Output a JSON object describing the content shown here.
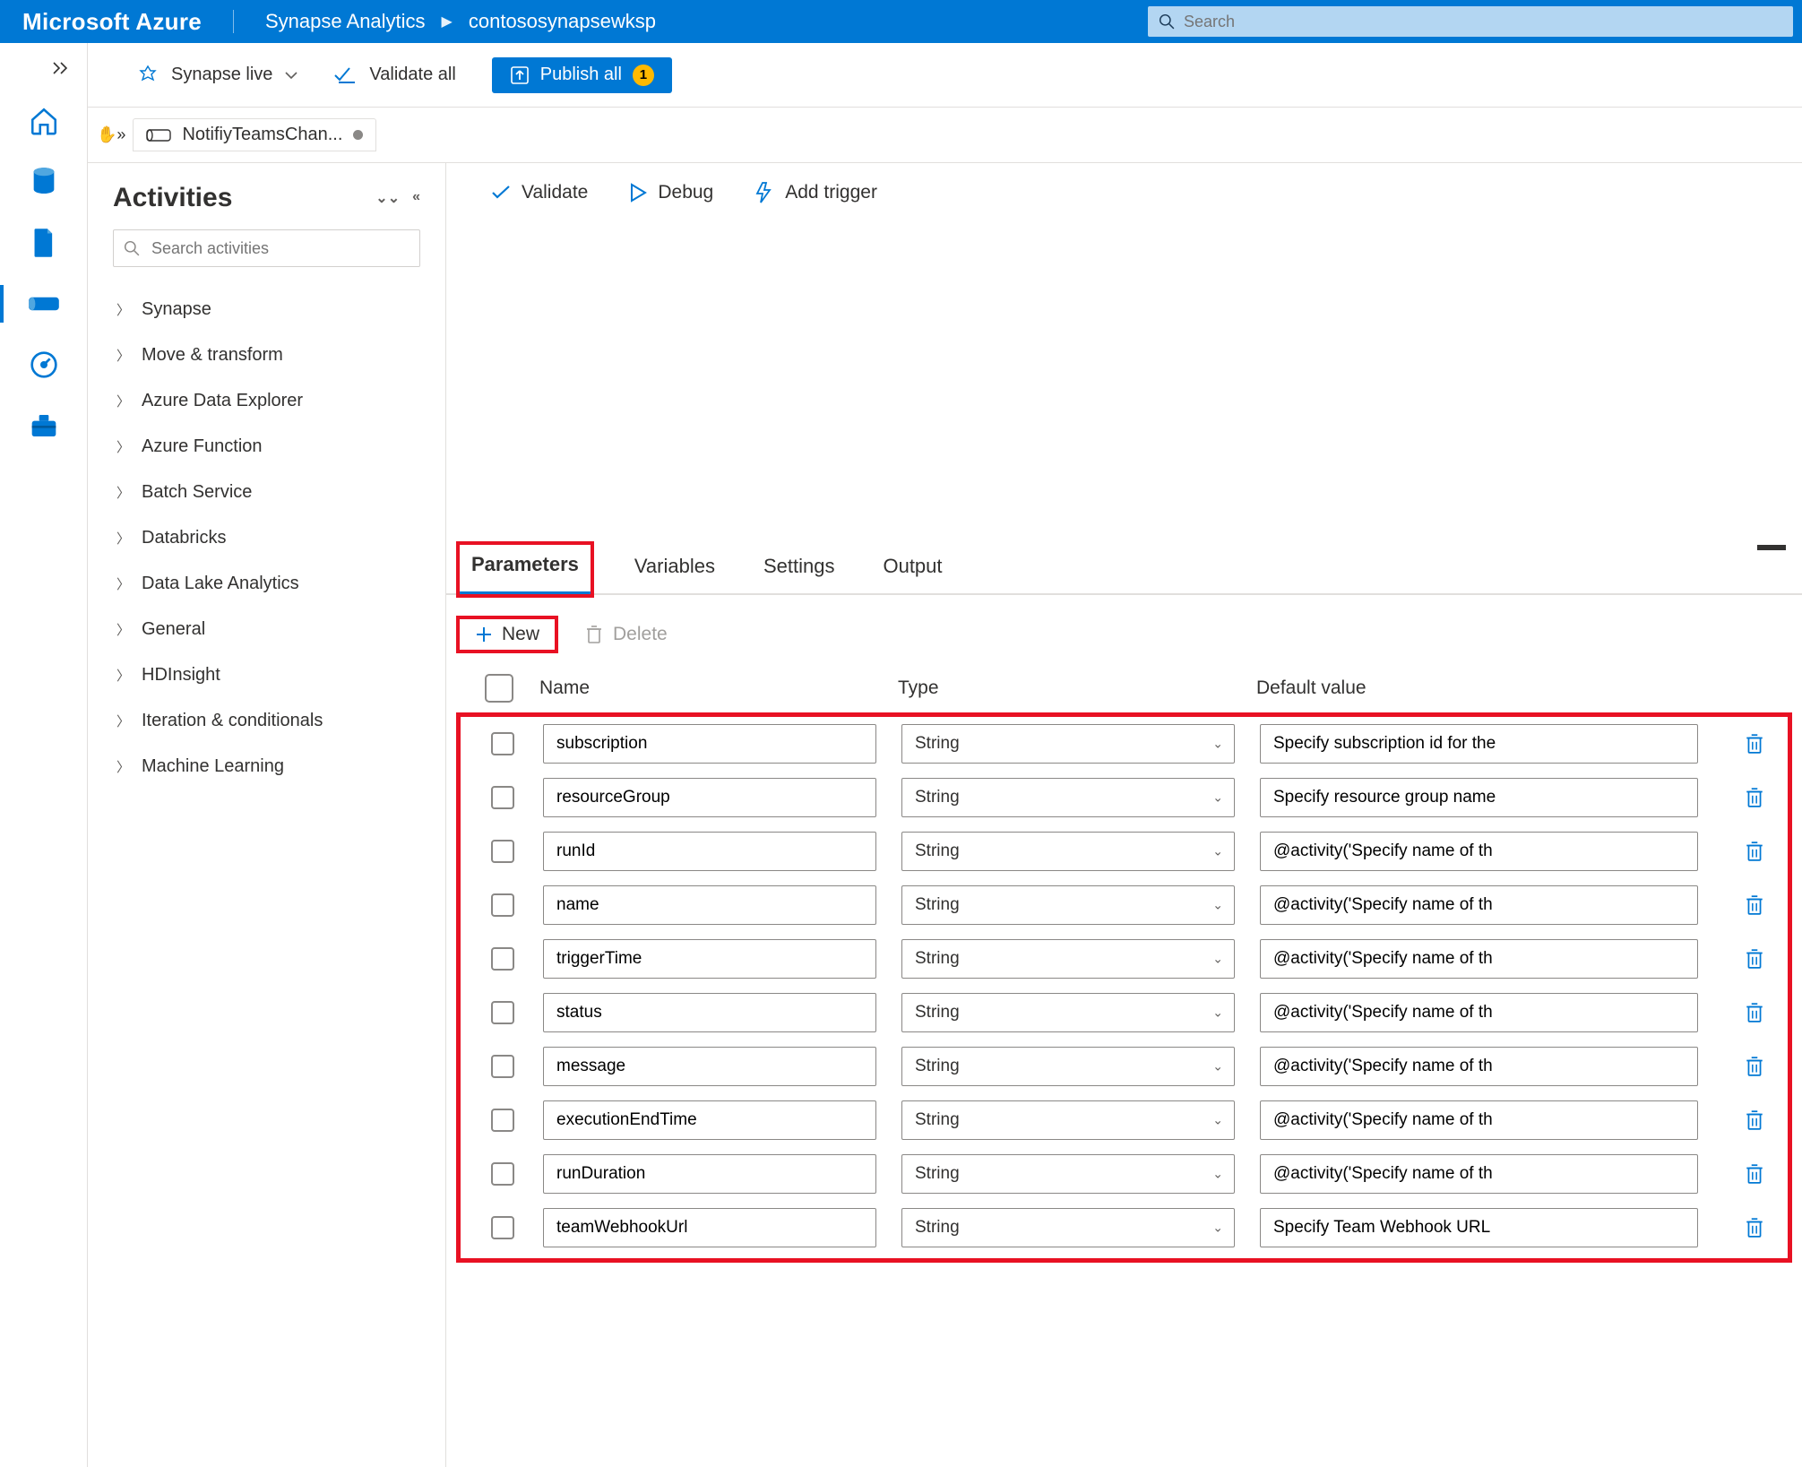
{
  "header": {
    "brand": "Microsoft Azure",
    "breadcrumb_service": "Synapse Analytics",
    "breadcrumb_workspace": "contososynapsewksp",
    "search_placeholder": "Search"
  },
  "actionbar": {
    "live_label": "Synapse live",
    "validate_all": "Validate all",
    "publish_all": "Publish all",
    "publish_badge": "1"
  },
  "pipeline_tab": {
    "name": "NotifiyTeamsChan..."
  },
  "activities_panel": {
    "title": "Activities",
    "search_placeholder": "Search activities",
    "groups": [
      "Synapse",
      "Move & transform",
      "Azure Data Explorer",
      "Azure Function",
      "Batch Service",
      "Databricks",
      "Data Lake Analytics",
      "General",
      "HDInsight",
      "Iteration & conditionals",
      "Machine Learning"
    ]
  },
  "canvas_toolbar": {
    "validate": "Validate",
    "debug": "Debug",
    "add_trigger": "Add trigger"
  },
  "bottom_tabs": {
    "parameters": "Parameters",
    "variables": "Variables",
    "settings": "Settings",
    "output": "Output"
  },
  "param_actions": {
    "new": "New",
    "delete": "Delete"
  },
  "param_headers": {
    "name": "Name",
    "type": "Type",
    "default": "Default value"
  },
  "type_string": "String",
  "parameters": [
    {
      "name": "subscription",
      "type": "String",
      "default": "Specify subscription id for the"
    },
    {
      "name": "resourceGroup",
      "type": "String",
      "default": "Specify resource group name"
    },
    {
      "name": "runId",
      "type": "String",
      "default": "@activity('Specify name of th"
    },
    {
      "name": "name",
      "type": "String",
      "default": "@activity('Specify name of th"
    },
    {
      "name": "triggerTime",
      "type": "String",
      "default": "@activity('Specify name of th"
    },
    {
      "name": "status",
      "type": "String",
      "default": "@activity('Specify name of th"
    },
    {
      "name": "message",
      "type": "String",
      "default": "@activity('Specify name of th"
    },
    {
      "name": "executionEndTime",
      "type": "String",
      "default": "@activity('Specify name of th"
    },
    {
      "name": "runDuration",
      "type": "String",
      "default": "@activity('Specify name of th"
    },
    {
      "name": "teamWebhookUrl",
      "type": "String",
      "default": "Specify Team Webhook URL"
    }
  ]
}
